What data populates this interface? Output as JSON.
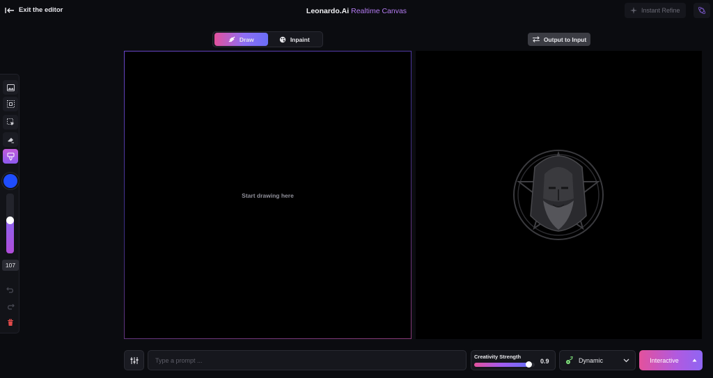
{
  "header": {
    "exit_label": "Exit the editor",
    "app_name": "Leonardo.Ai",
    "app_subtitle": "Realtime Canvas",
    "instant_refine_label": "Instant Refine"
  },
  "mode_toggle": {
    "draw_label": "Draw",
    "inpaint_label": "Inpaint",
    "active": "Draw"
  },
  "output_to_input_label": "Output to Input",
  "canvas": {
    "draw_hint": "Start drawing here"
  },
  "toolbar": {
    "brush_color": "#1f4dff",
    "brush_size": "107",
    "brush_size_fraction": 0.55,
    "active_tool": "brush"
  },
  "bottom": {
    "prompt_placeholder": "Type a prompt ...",
    "prompt_value": "",
    "creativity_label": "Creativity Strength",
    "creativity_value": "0.9",
    "creativity_fraction": 0.9,
    "style_value": "Dynamic",
    "generate_label": "Interactive"
  },
  "colors": {
    "accent_pink": "#e3519c",
    "accent_purple": "#8e6ef5",
    "background": "#0b0c10"
  }
}
